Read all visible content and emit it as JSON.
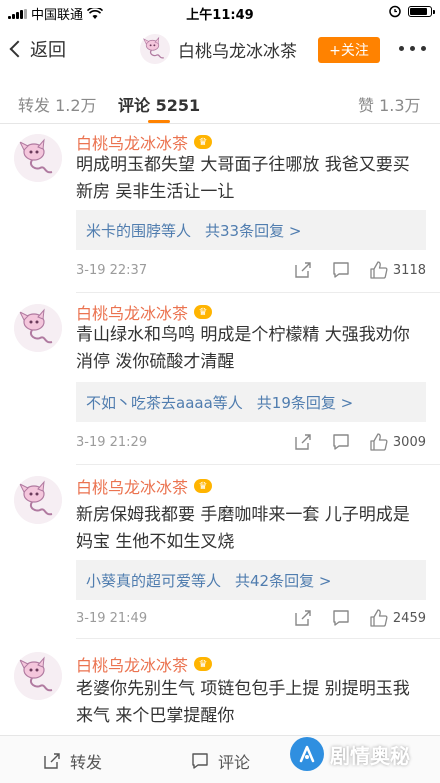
{
  "status_bar": {
    "carrier": "中国联通",
    "time": "上午11:49"
  },
  "nav": {
    "back_label": "返回",
    "title": "白桃乌龙冰冰茶",
    "follow_label": "+关注"
  },
  "tabs": {
    "repost": "转发 1.2万",
    "comments": "评论 5251",
    "likes": "赞 1.3万"
  },
  "comments": [
    {
      "name": "白桃乌龙冰冰茶",
      "line1": "明成明玉都失望 大哥面子往哪放 我爸又要买",
      "line2": "新房 吴非生活让一让",
      "reply_user": "米卡的围脖等人",
      "reply_count": "共33条回复 >",
      "time": "3-19 22:37",
      "likes": "3118"
    },
    {
      "name": "白桃乌龙冰冰茶",
      "line1": "青山绿水和鸟鸣 明成是个柠檬精 大强我劝你",
      "line2": "消停 泼你硫酸才清醒",
      "reply_user": "不如丶吃茶去aaaa等人",
      "reply_count": "共19条回复 >",
      "time": "3-19 21:29",
      "likes": "3009"
    },
    {
      "name": "白桃乌龙冰冰茶",
      "line1": "新房保姆我都要 手磨咖啡来一套 儿子明成是",
      "line2": "妈宝 生他不如生叉烧",
      "reply_user": "小葵真的超可爱等人",
      "reply_count": "共42条回复 >",
      "time": "3-19 21:49",
      "likes": "2459"
    },
    {
      "name": "白桃乌龙冰冰茶",
      "line1": "老婆你先别生气 项链包包手上提 别提明玉我",
      "line2": "来气 来个巴掌提醒你"
    }
  ],
  "bottom_bar": {
    "repost": "转发",
    "comment": "评论"
  },
  "watermark": {
    "text": "剧情奥秘"
  },
  "colors": {
    "accent": "#ff8200",
    "username": "#eb7350",
    "link": "#507daf"
  }
}
